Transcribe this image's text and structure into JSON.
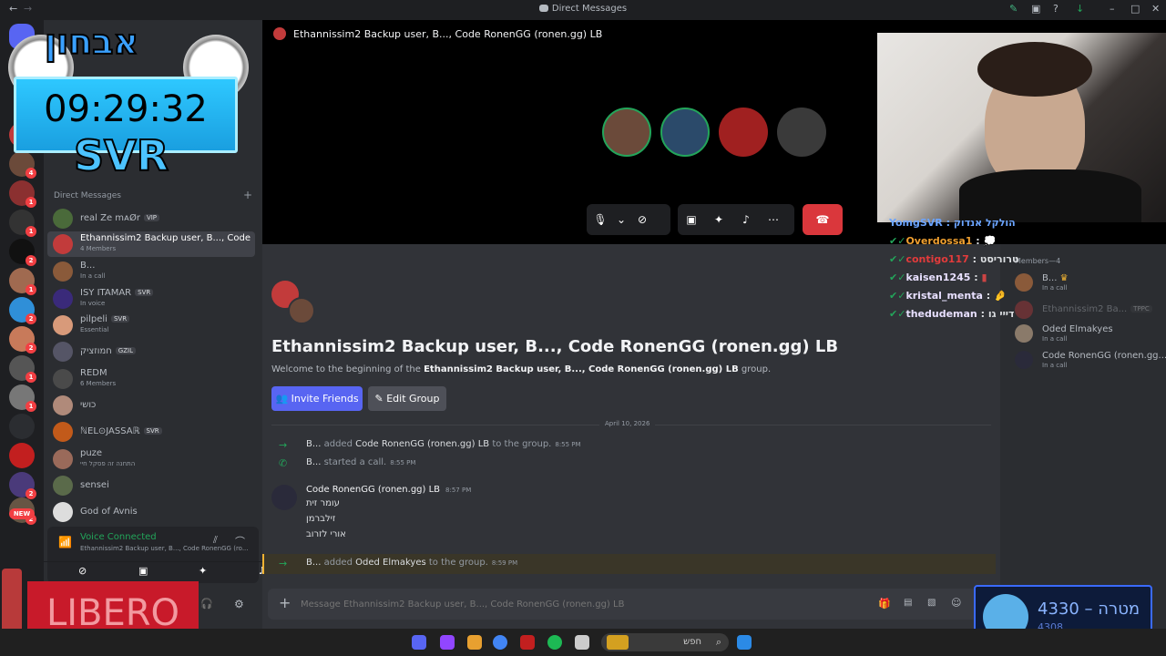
{
  "window": {
    "title": "Direct Messages"
  },
  "overlay": {
    "clock": "09:29:32",
    "brand": "SVR",
    "logo_text": "אבחון"
  },
  "servers": {
    "badges": [
      "4",
      "1",
      "1",
      "2",
      "1",
      "2",
      "2",
      "1",
      "1",
      "2",
      "2",
      "NEW"
    ]
  },
  "dm_panel": {
    "header": "Direct Messages",
    "items": [
      {
        "name": "real Ze mᴀØr",
        "tag": "VIP",
        "sub": ""
      },
      {
        "name": "Ethannissim2 Backup user, B..., Code Ro...",
        "tag": "",
        "sub": "4 Members"
      },
      {
        "name": "B...",
        "tag": "",
        "sub": "In a call"
      },
      {
        "name": "ISY ITAMAR",
        "tag": "SVR",
        "sub": "In voice"
      },
      {
        "name": "pilpeli",
        "tag": "SVR",
        "sub": "Essential"
      },
      {
        "name": "חמוזציק",
        "tag": "GZIL",
        "sub": ""
      },
      {
        "name": "REDM",
        "tag": "",
        "sub": "6 Members"
      },
      {
        "name": "כושי",
        "tag": "",
        "sub": ""
      },
      {
        "name": "ℕEL⊙JASSAℝ",
        "tag": "SVR",
        "sub": ""
      },
      {
        "name": "puze",
        "tag": "",
        "sub": "התחנה זה פסקל חיי"
      },
      {
        "name": "sensei",
        "tag": "",
        "sub": ""
      },
      {
        "name": "God of Avnis",
        "tag": "",
        "sub": ""
      }
    ],
    "voice_status": "Voice Connected",
    "voice_channel": "Ethannissim2 Backup user, B..., Code RonenGG (ro..."
  },
  "call": {
    "header": "Ethannissim2 Backup user, B..., Code RonenGG (ronen.gg) LB"
  },
  "chat": {
    "heading": "Ethannissim2 Backup user, B..., Code RonenGG (ronen.gg) LB",
    "welcome_prefix": "Welcome to the beginning of the",
    "welcome_group": "Ethannissim2 Backup user, B..., Code RonenGG (ronen.gg) LB",
    "welcome_suffix": "group.",
    "invite_label": "Invite Friends",
    "edit_label": "Edit Group",
    "date_divider": "April 10, 2026",
    "events": [
      {
        "actor": "B...",
        "action": "added",
        "target": "Code RonenGG (ronen.gg) LB",
        "rest": "to the group.",
        "time": "8:55 PM"
      },
      {
        "actor": "B...",
        "action": "started a call.",
        "target": "",
        "rest": "",
        "time": "8:55 PM"
      }
    ],
    "message": {
      "author": "Code RonenGG (ronen.gg) LB",
      "time": "8:57 PM",
      "lines": [
        "עומר זית",
        "זילברמן",
        "אורי לזרוב"
      ]
    },
    "last_event": {
      "actor": "B...",
      "action": "added",
      "target": "Oded Elmakyes",
      "rest": "to the group.",
      "time": "8:59 PM"
    },
    "input_placeholder": "Message Ethannissim2 Backup user, B..., Code RonenGG (ronen.gg) LB"
  },
  "members": {
    "header": "Members—4",
    "items": [
      {
        "name": "B...",
        "sub": "In a call"
      },
      {
        "name": "Ethannissim2 Ba...",
        "sub": "",
        "tag": "TPPC"
      },
      {
        "name": "Oded Elmakyes",
        "sub": "In a call"
      },
      {
        "name": "Code RonenGG (ronen.gg...",
        "sub": "In a call"
      }
    ]
  },
  "stream_chat": [
    {
      "user": "YomgSVR",
      "color": "#6ba4ff",
      "msg": "הולקל אנדוק"
    },
    {
      "user": "Overdossa1",
      "color": "#f0a030",
      "msg": "💭"
    },
    {
      "user": "contigo117",
      "color": "#e23b3b",
      "msg": "טרוריסט"
    },
    {
      "user": "kaisen1245",
      "color": "#e8e0ff",
      "msg": "▮"
    },
    {
      "user": "kristal_menta",
      "color": "#e8e0ff",
      "msg": "🤌"
    },
    {
      "user": "thedudeman",
      "color": "#e8e0ff",
      "msg": "דייי גו"
    }
  ],
  "goal_widget": {
    "value": "4330",
    "dash": "–",
    "label": "מטרה",
    "sub": "4308"
  },
  "sponsor": {
    "text": "LIBERO"
  },
  "taskbar": {
    "search": "חפש"
  },
  "colors": {
    "accent": "#5865f2",
    "danger": "#da373c",
    "online": "#23a55a"
  }
}
